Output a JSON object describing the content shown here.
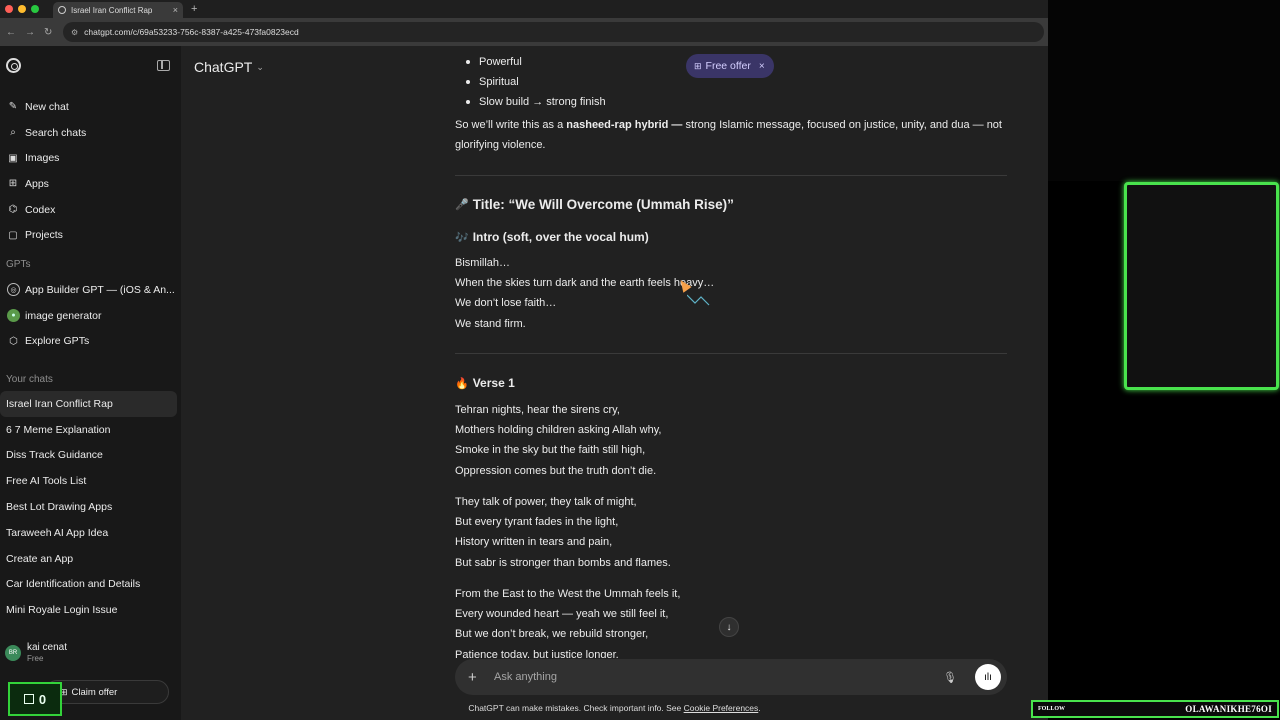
{
  "browser": {
    "tab_title": "Israel Iran Conflict Rap",
    "tab_close": "×",
    "new_tab": "+",
    "url": "chatgpt.com/c/69a53233-756c-8387-a425-473fa0823ecd",
    "back": "←",
    "forward": "→",
    "reload": "↻"
  },
  "sidebar": {
    "menu": [
      {
        "label": "New chat",
        "icon": "✎"
      },
      {
        "label": "Search chats",
        "icon": "⌕"
      },
      {
        "label": "Images",
        "icon": "▣"
      },
      {
        "label": "Apps",
        "icon": "⊞"
      },
      {
        "label": "Codex",
        "icon": "⌬"
      },
      {
        "label": "Projects",
        "icon": "▢"
      }
    ],
    "gpts_heading": "GPTs",
    "gpts": [
      {
        "label": "App Builder GPT — (iOS & An...",
        "icon": "◎"
      },
      {
        "label": "image generator",
        "icon": "●"
      },
      {
        "label": "Explore GPTs",
        "icon": "⬡"
      }
    ],
    "chats_heading": "Your chats",
    "chats": [
      "Israel Iran Conflict Rap",
      "6 7 Meme Explanation",
      "Diss Track Guidance",
      "Free AI Tools List",
      "Best Lot Drawing Apps",
      "Taraweeh AI App Idea",
      "Create an App",
      "Car Identification and Details",
      "Mini Royale Login Issue"
    ],
    "user": {
      "name": "kai cenat",
      "plan": "Free",
      "initials": "BR"
    },
    "claim_offer": "Claim offer",
    "counter": "0"
  },
  "header": {
    "model": "ChatGPT",
    "free_offer": "Free offer"
  },
  "message": {
    "bullets": [
      "Powerful",
      "Spiritual",
      "Slow build → strong finish"
    ],
    "intro_pre": "So we’ll write this as a ",
    "intro_bold": "nasheed-rap hybrid —",
    "intro_post": " strong Islamic message, focused on justice, unity, and dua — not glorifying violence.",
    "title_emoji": "🎤",
    "title": "Title: “We Will Overcome (Ummah Rise)”",
    "intro_emoji": "🎶",
    "intro_heading": "Intro (soft, over the vocal hum)",
    "intro_lines": [
      "Bismillah…",
      "When the skies turn dark and the earth feels heavy…",
      "We don’t lose faith…",
      "We stand firm."
    ],
    "verse_emoji": "🔥",
    "verse_heading": "Verse 1",
    "stanza1": [
      "Tehran nights, hear the sirens cry,",
      "Mothers holding children asking Allah why,",
      "Smoke in the sky but the faith still high,",
      "Oppression comes but the truth don’t die."
    ],
    "stanza2": [
      "They talk of power, they talk of might,",
      "But every tyrant fades in the light,",
      "History written in tears and pain,",
      "But sabr is stronger than bombs and flames."
    ],
    "stanza3": [
      "From the East to the West the Ummah feels it,",
      "Every wounded heart — yeah we still feel it,",
      "But we don’t break, we rebuild stronger,",
      "Patience today, but justice longer."
    ]
  },
  "composer": {
    "placeholder": "Ask anything"
  },
  "disclaimer": {
    "text": "ChatGPT can make mistakes. Check important info. See ",
    "link": "Cookie Preferences",
    "end": "."
  },
  "overlay": {
    "follow": "FOLLOW",
    "handle": "OLAWANIKHE76OI"
  },
  "colors": {
    "sidebar_bg": "#181818",
    "main_bg": "#212121",
    "offer_bg": "#3a3567",
    "overlay_green": "#49e34d"
  }
}
